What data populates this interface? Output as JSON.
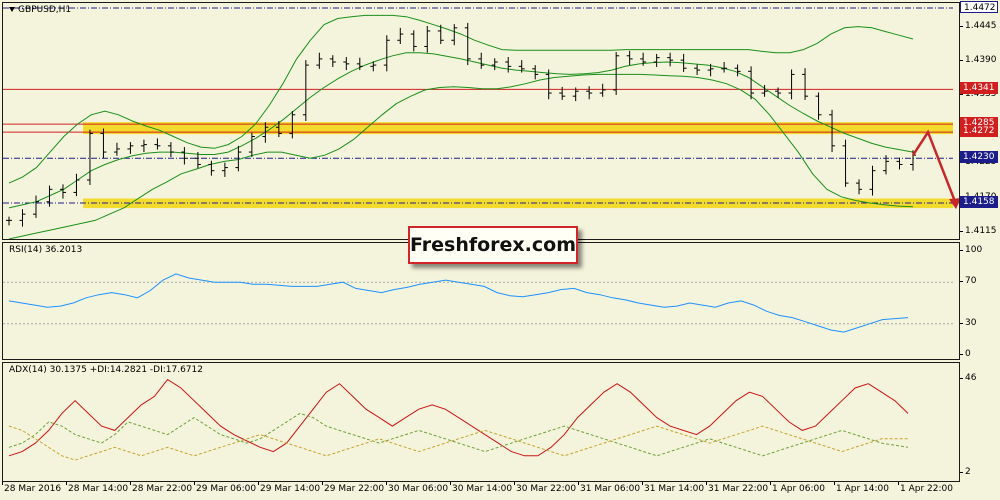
{
  "chart_data": [
    {
      "type": "candlestick",
      "title": "GBPUSD,H1",
      "y_ticks": [
        "1.4472",
        "1.4445",
        "1.4390",
        "1.4335",
        "1.4280",
        "1.4225",
        "1.4170",
        "1.4115"
      ],
      "ylim": [
        1.41,
        1.448
      ],
      "price_path": [
        1.413,
        1.414,
        1.416,
        1.418,
        1.4175,
        1.4195,
        1.427,
        1.424,
        1.4245,
        1.425,
        1.4252,
        1.425,
        1.424,
        1.423,
        1.422,
        1.421,
        1.4215,
        1.424,
        1.4265,
        1.428,
        1.427,
        1.43,
        1.438,
        1.439,
        1.4385,
        1.4382,
        1.4378,
        1.438,
        1.442,
        1.443,
        1.441,
        1.4435,
        1.442,
        1.444,
        1.439,
        1.438,
        1.4385,
        1.4378,
        1.4374,
        1.4365,
        1.4335,
        1.433,
        1.4338,
        1.4335,
        1.434,
        1.4395,
        1.439,
        1.4385,
        1.4392,
        1.4388,
        1.4375,
        1.4372,
        1.4374,
        1.4375,
        1.437,
        1.4335,
        1.4338,
        1.4335,
        1.4365,
        1.433,
        1.43,
        1.425,
        1.419,
        1.418,
        1.421,
        1.4225,
        1.422,
        1.4235
      ],
      "bands": {
        "upper": [
          1.419,
          1.42,
          1.4215,
          1.424,
          1.4265,
          1.4285,
          1.43,
          1.4306,
          1.43,
          1.429,
          1.4282,
          1.4275,
          1.4265,
          1.4255,
          1.4248,
          1.4246,
          1.4252,
          1.4265,
          1.4285,
          1.4315,
          1.435,
          1.439,
          1.442,
          1.4445,
          1.4455,
          1.4458,
          1.446,
          1.446,
          1.446,
          1.4458,
          1.4452,
          1.4445,
          1.4438,
          1.443,
          1.442,
          1.4412,
          1.4405,
          1.4404,
          1.4404,
          1.4404,
          1.4404,
          1.4404,
          1.4404,
          1.4404,
          1.4404,
          1.4405,
          1.4405,
          1.4405,
          1.4405,
          1.4405,
          1.4405,
          1.4405,
          1.4405,
          1.4405,
          1.4405,
          1.4402,
          1.44,
          1.44,
          1.4405,
          1.4415,
          1.443,
          1.444,
          1.4442,
          1.444,
          1.4434,
          1.4428,
          1.4422
        ],
        "middle": [
          1.415,
          1.4155,
          1.416,
          1.417,
          1.418,
          1.4195,
          1.421,
          1.422,
          1.4228,
          1.4234,
          1.4238,
          1.424,
          1.424,
          1.4238,
          1.4236,
          1.4236,
          1.424,
          1.425,
          1.4262,
          1.4276,
          1.4292,
          1.431,
          1.4328,
          1.4344,
          1.4358,
          1.437,
          1.438,
          1.4388,
          1.4395,
          1.44,
          1.44,
          1.4398,
          1.4394,
          1.439,
          1.4385,
          1.438,
          1.4375,
          1.4372,
          1.437,
          1.4368,
          1.4366,
          1.4365,
          1.4366,
          1.4368,
          1.4372,
          1.4378,
          1.4382,
          1.4384,
          1.4385,
          1.4384,
          1.4382,
          1.438,
          1.4376,
          1.437,
          1.436,
          1.4345,
          1.433,
          1.4315,
          1.4302,
          1.429,
          1.428,
          1.427,
          1.4262,
          1.4254,
          1.4248,
          1.4244,
          1.424
        ],
        "lower": [
          1.41,
          1.4105,
          1.411,
          1.4115,
          1.412,
          1.4125,
          1.413,
          1.414,
          1.415,
          1.4165,
          1.418,
          1.4192,
          1.4205,
          1.4212,
          1.422,
          1.4225,
          1.4228,
          1.4235,
          1.424,
          1.424,
          1.4235,
          1.423,
          1.4235,
          1.4245,
          1.426,
          1.428,
          1.43,
          1.4318,
          1.433,
          1.434,
          1.4344,
          1.4345,
          1.4344,
          1.4342,
          1.4342,
          1.4345,
          1.435,
          1.4356,
          1.436,
          1.4362,
          1.4364,
          1.4365,
          1.4365,
          1.4365,
          1.4365,
          1.4364,
          1.4363,
          1.4362,
          1.436,
          1.4356,
          1.435,
          1.434,
          1.4325,
          1.43,
          1.427,
          1.424,
          1.4205,
          1.418,
          1.4168,
          1.4162,
          1.4158,
          1.4155,
          1.4153,
          1.4152
        ]
      },
      "levels": [
        {
          "label": "1.4472",
          "value": 1.4472,
          "style": "dashdot",
          "color": "#1c1c8a"
        },
        {
          "label": "1.4341",
          "value": 1.4341,
          "style": "solid",
          "color": "#d11f1f",
          "badge_color": "#d11f1f"
        },
        {
          "label": "1.4285",
          "value": 1.4285,
          "style": "solid",
          "color": "#d11f1f",
          "badge_color": "#d11f1f"
        },
        {
          "label": "1.4272",
          "value": 1.4272,
          "style": "solid",
          "color": "#d11f1f",
          "badge_color": "#d11f1f"
        },
        {
          "label": "1.4230",
          "value": 1.423,
          "style": "dashdot",
          "color": "#1c1c8a",
          "badge_color": "#1c1c8a"
        },
        {
          "label": "1.4158",
          "value": 1.4158,
          "style": "dashdot",
          "color": "#1c1c8a",
          "badge_color": "#1c1c8a"
        }
      ],
      "zones": [
        {
          "from": 1.4272,
          "to": 1.4285,
          "color": "#f2d60f"
        },
        {
          "from": 1.4153,
          "to": 1.4162,
          "color": "#f2d60f"
        }
      ],
      "colors": {
        "candles": "#000000",
        "bands": "#1a8f1a",
        "forecast_arrow": "#c9262a"
      }
    },
    {
      "type": "line",
      "title": "RSI(14) 36.2013",
      "y_ticks": [
        "100",
        "70",
        "30",
        "0"
      ],
      "ylim": [
        0,
        100
      ],
      "levels": [
        70,
        30
      ],
      "values": [
        52,
        50,
        48,
        46,
        47,
        50,
        55,
        58,
        60,
        58,
        55,
        62,
        72,
        78,
        74,
        72,
        70,
        70,
        70,
        68,
        68,
        67,
        66,
        66,
        66,
        68,
        70,
        64,
        62,
        60,
        63,
        65,
        68,
        70,
        72,
        70,
        68,
        66,
        60,
        57,
        56,
        58,
        60,
        63,
        64,
        60,
        58,
        55,
        53,
        50,
        48,
        46,
        47,
        50,
        48,
        46,
        50,
        52,
        48,
        42,
        38,
        36,
        32,
        28,
        24,
        22,
        26,
        30,
        34,
        35,
        36
      ],
      "color": "#1e90ff"
    },
    {
      "type": "line",
      "title": "ADX(14) 30.1375 +DI:14.2821 -DI:17.6712",
      "y_ticks": [
        "46",
        "2"
      ],
      "ylim": [
        0,
        50
      ],
      "series": [
        {
          "name": "ADX(14)",
          "values": [
            10,
            12,
            16,
            22,
            30,
            36,
            30,
            24,
            22,
            28,
            34,
            38,
            46,
            42,
            36,
            30,
            24,
            20,
            17,
            14,
            12,
            16,
            24,
            32,
            40,
            44,
            38,
            32,
            28,
            24,
            28,
            32,
            34,
            32,
            28,
            24,
            20,
            16,
            12,
            10,
            10,
            14,
            20,
            28,
            34,
            40,
            44,
            40,
            34,
            28,
            24,
            22,
            20,
            24,
            30,
            36,
            40,
            38,
            32,
            26,
            22,
            24,
            30,
            36,
            42,
            44,
            40,
            36,
            30
          ]
        },
        {
          "name": "+DI",
          "values": [
            14,
            16,
            20,
            26,
            24,
            20,
            18,
            16,
            20,
            26,
            24,
            22,
            20,
            24,
            28,
            24,
            20,
            18,
            16,
            18,
            22,
            26,
            30,
            28,
            24,
            22,
            20,
            18,
            16,
            18,
            20,
            22,
            20,
            18,
            16,
            14,
            12,
            14,
            16,
            18,
            20,
            22,
            24,
            22,
            20,
            18,
            16,
            14,
            12,
            10,
            12,
            14,
            16,
            18,
            16,
            14,
            12,
            10,
            12,
            14,
            16,
            18,
            20,
            22,
            20,
            18,
            16,
            15,
            14
          ]
        },
        {
          "name": "-DI",
          "values": [
            24,
            22,
            18,
            14,
            10,
            8,
            10,
            12,
            14,
            12,
            10,
            12,
            14,
            12,
            10,
            12,
            14,
            16,
            18,
            20,
            18,
            16,
            14,
            12,
            10,
            12,
            14,
            16,
            18,
            16,
            14,
            12,
            14,
            16,
            18,
            20,
            22,
            20,
            18,
            16,
            14,
            12,
            10,
            12,
            14,
            16,
            18,
            20,
            22,
            24,
            22,
            20,
            18,
            16,
            18,
            20,
            22,
            24,
            22,
            20,
            18,
            16,
            14,
            12,
            14,
            16,
            18,
            18,
            18
          ]
        }
      ],
      "colors": {
        "ADX(14)": "#cc1414",
        "+DI": "#6fa13a",
        "-DI": "#c6a32e"
      }
    }
  ],
  "time_axis": {
    "ticks": [
      "28 Mar 2016",
      "28 Mar 14:00",
      "28 Mar 22:00",
      "29 Mar 06:00",
      "29 Mar 14:00",
      "29 Mar 22:00",
      "30 Mar 06:00",
      "30 Mar 14:00",
      "30 Mar 22:00",
      "31 Mar 06:00",
      "31 Mar 14:00",
      "31 Mar 22:00",
      "1 Apr 06:00",
      "1 Apr 14:00",
      "1 Apr 22:00"
    ]
  },
  "watermark": {
    "text": "Freshforex.com"
  }
}
